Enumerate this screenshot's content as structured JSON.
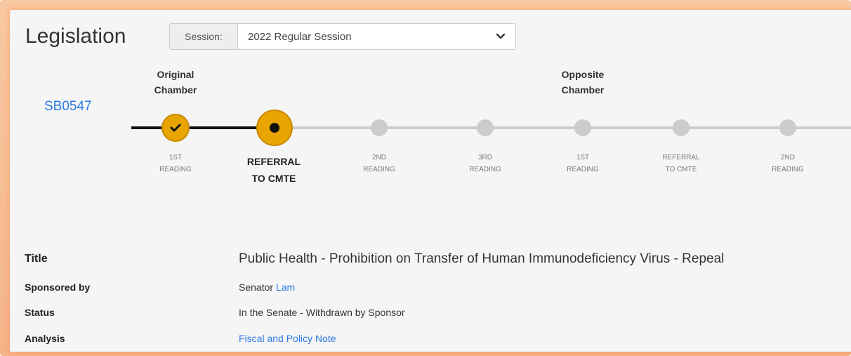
{
  "header": {
    "title": "Legislation",
    "session_label": "Session:",
    "session_value": "2022 Regular Session"
  },
  "bill": {
    "id": "SB0547"
  },
  "chambers": {
    "original": [
      "Original",
      "Chamber"
    ],
    "opposite": [
      "Opposite",
      "Chamber"
    ]
  },
  "steps": [
    {
      "line1": "1ST",
      "line2": "READING",
      "state": "done"
    },
    {
      "line1": "REFERRAL",
      "line2": "TO CMTE",
      "state": "current"
    },
    {
      "line1": "2ND",
      "line2": "READING",
      "state": "future"
    },
    {
      "line1": "3RD",
      "line2": "READING",
      "state": "future"
    },
    {
      "line1": "1ST",
      "line2": "READING",
      "state": "future"
    },
    {
      "line1": "REFERRAL",
      "line2": "TO CMTE",
      "state": "future"
    },
    {
      "line1": "2ND",
      "line2": "READING",
      "state": "future"
    }
  ],
  "details": {
    "title_label": "Title",
    "title_value": "Public Health - Prohibition on Transfer of Human Immunodeficiency Virus - Repeal",
    "sponsor_label": "Sponsored by",
    "sponsor_prefix": "Senator",
    "sponsor_name": "Lam",
    "status_label": "Status",
    "status_value": "In the Senate - Withdrawn by Sponsor",
    "analysis_label": "Analysis",
    "analysis_value": "Fiscal and Policy Note"
  },
  "colors": {
    "accent": "#e8a400",
    "link": "#2c7be5",
    "frame": "#f4b489"
  }
}
